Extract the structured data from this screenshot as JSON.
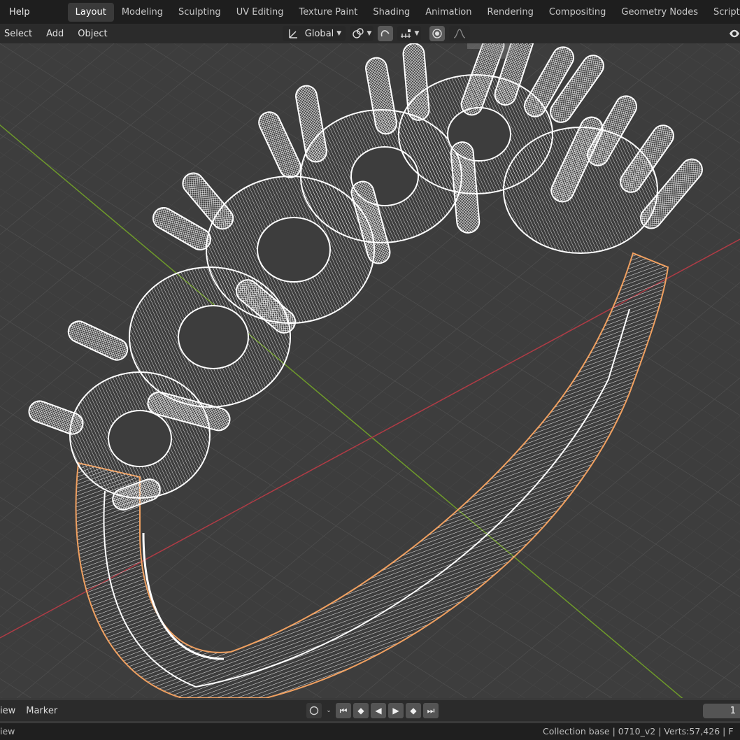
{
  "topbar": {
    "help": "Help",
    "tabs": [
      "Layout",
      "Modeling",
      "Sculpting",
      "UV Editing",
      "Texture Paint",
      "Shading",
      "Animation",
      "Rendering",
      "Compositing",
      "Geometry Nodes",
      "Scripting"
    ],
    "active_tab": "Layout"
  },
  "viewport_header": {
    "menus": [
      "Select",
      "Add",
      "Object"
    ],
    "transform_orientation": "Global"
  },
  "timeline": {
    "view_menu": "iew",
    "marker_menu": "Marker",
    "current_frame": "1"
  },
  "statusbar": {
    "left": "iew",
    "collection": "Collection base",
    "object": "0710_v2",
    "verts": "Verts:57,426",
    "truncated": "F"
  },
  "colors": {
    "grid_bg": "#3d3d3d",
    "x_axis": "#b03b45",
    "y_axis": "#6e9a2a",
    "wire": "#ffffff",
    "selection_outline": "#f0a060",
    "active_tab_bg": "#3a3a3a"
  },
  "icons": {
    "transform": "transform-orientation-icon",
    "pivot": "pivot-point-icon",
    "snap": "snap-magnet-icon",
    "snap_target": "snap-increment-icon",
    "proportional": "proportional-edit-icon",
    "falloff": "falloff-curve-icon",
    "visibility": "eye-icon"
  }
}
